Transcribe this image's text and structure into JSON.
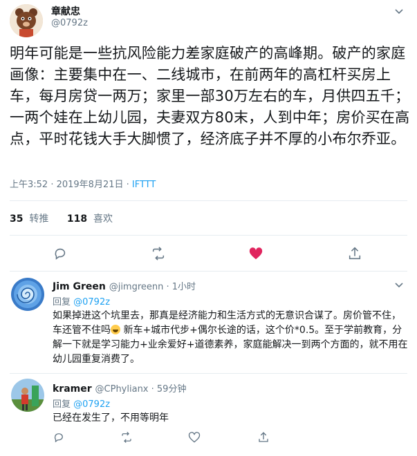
{
  "main_tweet": {
    "author_name": "章献忠",
    "author_handle": "@0792z",
    "text": "明年可能是一些抗风险能力差家庭破产的高峰期。破产的家庭画像：主要集中在一、二线城市，在前两年的高杠杆买房上车，每月房贷一两万；家里一部30万左右的车，月供四五千；一两个娃在上幼儿园，夫妻双方80末，人到中年；房价买在高点，平时花钱大手大脚惯了，经济底子并不厚的小布尔乔亚。",
    "timestamp": "上午3:52 · 2019年8月21日 · ",
    "source": "IFTTT",
    "retweets_count": "35",
    "retweets_label": "转推",
    "likes_count": "118",
    "likes_label": "喜欢",
    "liked": true,
    "like_color": "#e0245e"
  },
  "replies": [
    {
      "author_name": "Jim Green",
      "author_handle": "@jimgreenn · 1小时",
      "reply_to_label": "回复 ",
      "reply_to_handle": "@0792z",
      "text_before_emoji": "如果掉进这个坑里去，那真是经济能力和生活方式的无意识合谋了。房价管不住，车还管不住吗",
      "text_after_emoji": "新车+城市代步+偶尔长途的话，这个价*0.5。至于学前教育，分解一下就是学习能力+业余爱好+道德素养，家庭能解决一到两个方面的，就不用在幼儿园重复消费了。",
      "emoji": "laughing-face"
    },
    {
      "author_name": "kramer",
      "author_handle": "@CPhylianx · 59分钟",
      "reply_to_label": "回复 ",
      "reply_to_handle": "@0792z",
      "text": "已经在发生了，不用等明年"
    }
  ],
  "colors": {
    "accent": "#1da1f2",
    "muted": "#657786",
    "divider": "#e6ecf0"
  }
}
